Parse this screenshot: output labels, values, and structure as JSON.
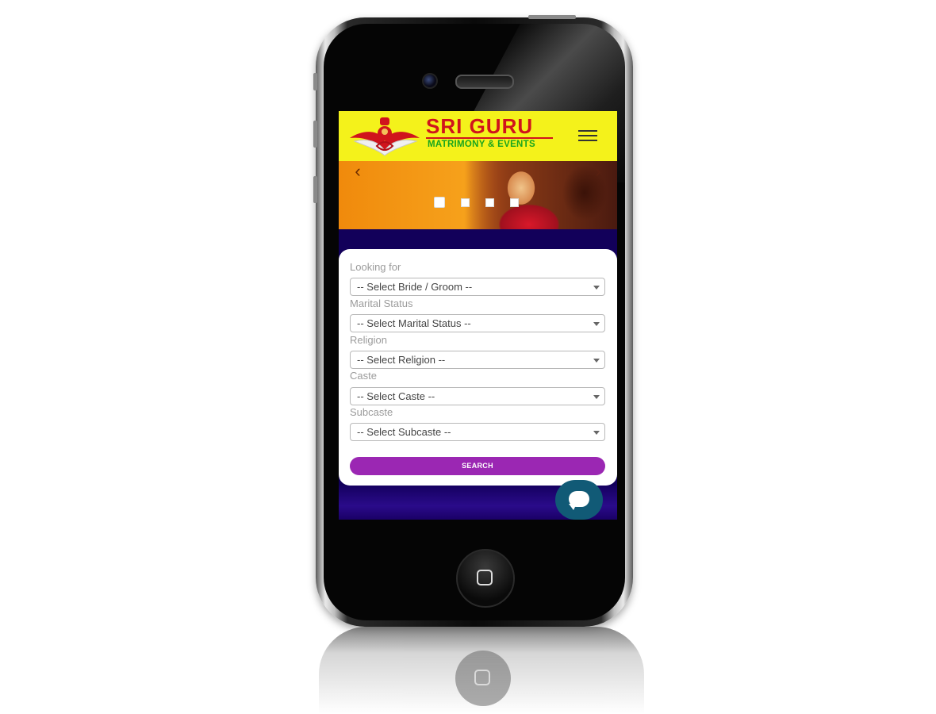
{
  "brand": {
    "title": "SRI GURU",
    "subtitle": "MATRIMONY & EVENTS",
    "accent_red": "#d0141c",
    "accent_green": "#19a51e",
    "header_bg": "#f4f21b"
  },
  "carousel": {
    "slide_caption": "",
    "prev_icon": "‹",
    "next_icon": "›",
    "slide_count": 4,
    "active_index": 0
  },
  "search_form": {
    "fields": [
      {
        "label": "Looking for",
        "value": "-- Select Bride / Groom --"
      },
      {
        "label": "Marital Status",
        "value": "-- Select Marital Status --"
      },
      {
        "label": "Religion",
        "value": "-- Select Religion --"
      },
      {
        "label": "Caste",
        "value": "-- Select Caste --"
      },
      {
        "label": "Subcaste",
        "value": "-- Select Subcaste --"
      }
    ],
    "submit_label": "SEARCH",
    "button_color": "#9b27b3"
  },
  "chat": {
    "icon": "chat-bubble-icon",
    "color": "#115a76"
  },
  "page_bg": "#12005a"
}
